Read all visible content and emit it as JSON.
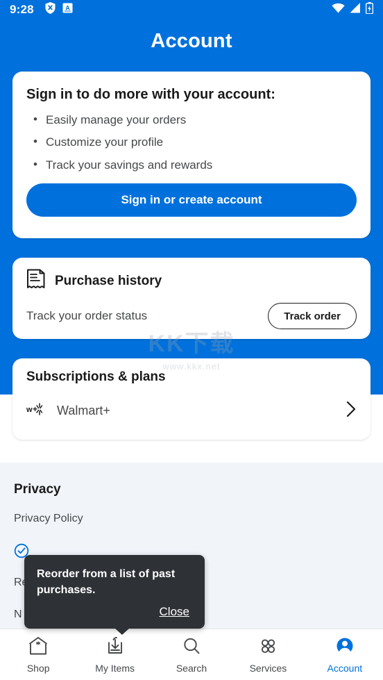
{
  "status_bar": {
    "time": "9:28",
    "left_icons": [
      "shield-x-icon",
      "boxed-a-icon"
    ],
    "right_icons": [
      "wifi-icon",
      "cellular-signal-icon",
      "battery-charging-icon"
    ]
  },
  "header": {
    "title": "Account",
    "background_color": "#0071dc"
  },
  "signin_card": {
    "heading": "Sign in to do more with your account:",
    "bullets": [
      "Easily manage your orders",
      "Customize your profile",
      "Track your savings and rewards"
    ],
    "button_label": "Sign in or create account"
  },
  "purchase_history_card": {
    "icon": "receipt-icon",
    "title": "Purchase history",
    "subtitle": "Track your order status",
    "button_label": "Track order"
  },
  "subscriptions_card": {
    "title": "Subscriptions & plans",
    "rows": [
      {
        "icon": "walmart-plus-spark-icon",
        "label": "Walmart+",
        "chevron": "chevron-right-icon"
      }
    ]
  },
  "watermark": {
    "main": "KK下载",
    "sub": "www.kkx.net"
  },
  "privacy": {
    "heading": "Privacy",
    "items": [
      {
        "label": "Privacy Policy",
        "icon": ""
      },
      {
        "label": "",
        "icon": "check-circle-icon"
      },
      {
        "label": "Re",
        "icon": ""
      },
      {
        "label": "N",
        "icon": ""
      }
    ]
  },
  "tooltip": {
    "text": "Reorder from a list of past purchases.",
    "close_label": "Close",
    "background_color": "#2e3236"
  },
  "bottom_nav": {
    "items": [
      {
        "label": "Shop",
        "icon": "store-icon",
        "active": false
      },
      {
        "label": "My Items",
        "icon": "tray-arrow-down-icon",
        "active": false
      },
      {
        "label": "Search",
        "icon": "search-icon",
        "active": false
      },
      {
        "label": "Services",
        "icon": "four-circles-icon",
        "active": false
      },
      {
        "label": "Account",
        "icon": "account-circle-icon",
        "active": true
      }
    ],
    "active_color": "#0071dc"
  }
}
